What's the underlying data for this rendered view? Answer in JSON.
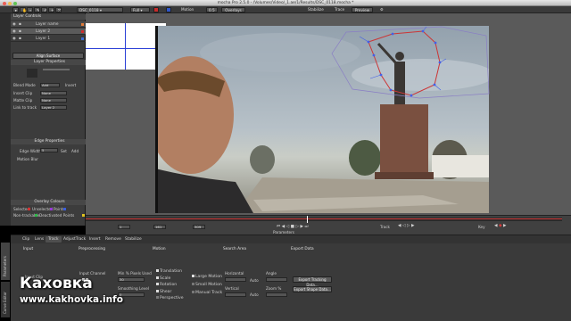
{
  "window": {
    "app_name": "mocha",
    "title": "mocha Pro 2.5.0 - /Volumes/Video/_1.ae/1/Results/DSC_0118.mocha *"
  },
  "toolbar": {
    "clip_name": "DSC_0118",
    "view_mode": "Full",
    "zoom": "0.5",
    "motion_label": "Motion",
    "overlays_label": "Overlays",
    "stabilize_label": "Stabilize",
    "trace_label": "Trace",
    "preview_label": "Preview"
  },
  "layer_controls": {
    "header": "Layer Controls",
    "layers": [
      {
        "name": "Layer name",
        "color": "#e07b39"
      },
      {
        "name": "Layer 2",
        "color": "#d12d2d"
      },
      {
        "name": "Layer 1",
        "color": "#3b6fd6"
      }
    ],
    "align_surface_label": "Align Surface"
  },
  "layer_properties": {
    "header": "Layer Properties",
    "blend_mode_label": "Blend Mode",
    "blend_mode_value": "Add",
    "invert_label": "Invert",
    "insert_clip_label": "Insert Clip",
    "insert_clip_value": "None",
    "matte_clip_label": "Matte Clip",
    "matte_clip_value": "None",
    "link_to_track_label": "Link to track",
    "link_to_track_value": "Layer 2"
  },
  "edge_properties": {
    "header": "Edge Properties",
    "edge_width_label": "Edge Width",
    "edge_width_value": "5",
    "set_label": "Set",
    "add_label": "Add",
    "motion_blur_label": "Motion Blur"
  },
  "overlay_colours": {
    "header": "Overlay Colours",
    "selected_label": "Selected",
    "unselected_label": "Unselected",
    "points_label": "Points",
    "non_trackable_label": "Non-trackable",
    "deactivated_label": "Deactivated Points",
    "colors": {
      "selected": "#d63030",
      "unselected": "#9a3cd6",
      "points": "#3b5fe0",
      "non_trackable": "#2fb84a",
      "deactivated": "#e0c21e"
    }
  },
  "timeline": {
    "start_frame": "1",
    "current_frame": "161",
    "end_frame": "309",
    "parameters_label": "Parameters",
    "track_label": "Track",
    "key_label": "Key",
    "playhead_fraction": 0.465
  },
  "bottom_tabs": [
    "Clip",
    "Lens",
    "Track",
    "AdjustTrack",
    "Insert",
    "Remove",
    "Stabilize"
  ],
  "active_bottom_tab": "Track",
  "side_tabs": [
    "Parameters",
    "Curve Editor"
  ],
  "track_params": {
    "input_header": "Input",
    "preprocessing_header": "Preprocessing",
    "motion_header": "Motion",
    "search_area_header": "Search Area",
    "export_data_header": "Export Data",
    "input_clip_label": "Input Clip",
    "input_channel_label": "Input Channel",
    "min_pixels_label": "Min % Pixels Used",
    "min_pixels_value": "30",
    "smoothing_label": "Smoothing Level",
    "smoothing_value": "0",
    "motion_options": [
      "Translation",
      "Scale",
      "Rotation",
      "Shear",
      "Perspective"
    ],
    "large_motion_label": "Large Motion",
    "small_motion_label": "Small Motion",
    "manual_track_label": "Manual Track",
    "horizontal_label": "Horizontal",
    "vertical_label": "Vertical",
    "auto_label": "Auto",
    "angle_label": "Angle",
    "zoom_label": "Zoom %",
    "export_tracking_label": "Export Tracking Data...",
    "export_shape_label": "Export Shape Data..."
  },
  "watermark": {
    "brand": "Каховка",
    "url": "www.kakhovka.info"
  }
}
